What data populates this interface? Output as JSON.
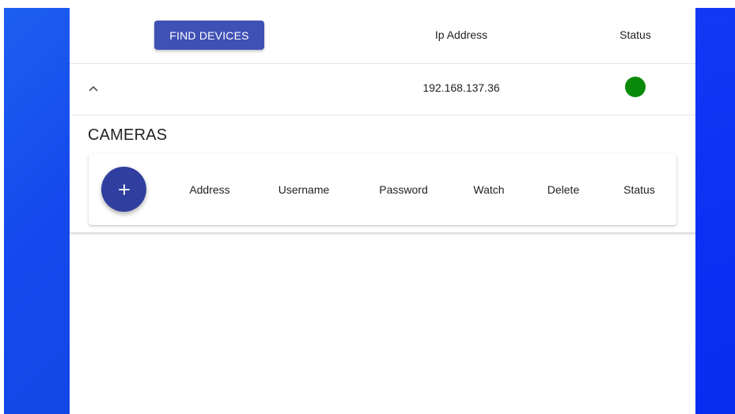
{
  "header": {
    "find_devices_label": "FIND DEVICES",
    "ip_address_label": "Ip Address",
    "status_label": "Status"
  },
  "device": {
    "ip": "192.168.137.36",
    "status_color": "#0a8a0a",
    "expand_icon": "chevron-up-icon"
  },
  "cameras": {
    "title": "CAMERAS",
    "add_icon": "plus-icon",
    "columns": [
      "Address",
      "Username",
      "Password",
      "Watch",
      "Delete",
      "Status"
    ]
  },
  "colors": {
    "accent": "#3f51b5",
    "fab": "#303f9f",
    "side_background": "#1449ee"
  }
}
